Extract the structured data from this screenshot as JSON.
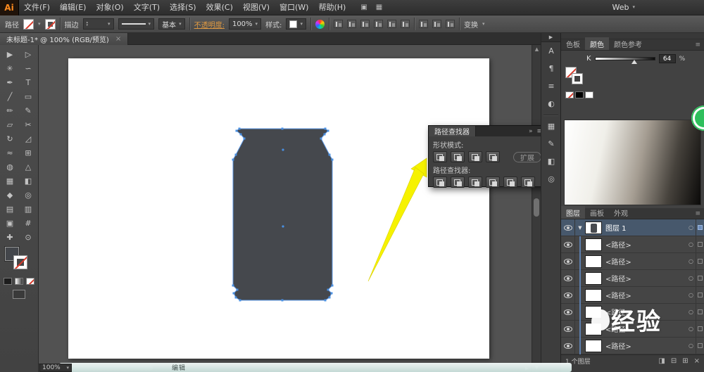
{
  "app": {
    "logo_text": "Ai",
    "workspace_label": "Web"
  },
  "menu": {
    "items": [
      "文件(F)",
      "编辑(E)",
      "对象(O)",
      "文字(T)",
      "选择(S)",
      "效果(C)",
      "视图(V)",
      "窗口(W)",
      "帮助(H)"
    ]
  },
  "control_bar": {
    "context_label": "路径",
    "stroke_label": "描边",
    "brush_value": "基本",
    "opacity_label": "不透明度:",
    "opacity_value": "100%",
    "style_label": "样式:",
    "transform_label": "变换"
  },
  "document_tab": {
    "title": "未标题-1* @ 100% (RGB/预览)"
  },
  "tools": [
    {
      "name": "selection",
      "glyph": "▶"
    },
    {
      "name": "direct-selection",
      "glyph": "▷"
    },
    {
      "name": "magic-wand",
      "glyph": "✳"
    },
    {
      "name": "lasso",
      "glyph": "∽"
    },
    {
      "name": "pen",
      "glyph": "✒"
    },
    {
      "name": "type",
      "glyph": "T"
    },
    {
      "name": "line-segment",
      "glyph": "╱"
    },
    {
      "name": "rectangle",
      "glyph": "▭"
    },
    {
      "name": "paintbrush",
      "glyph": "✏"
    },
    {
      "name": "pencil",
      "glyph": "✎"
    },
    {
      "name": "eraser",
      "glyph": "▱"
    },
    {
      "name": "scissors",
      "glyph": "✂"
    },
    {
      "name": "rotate",
      "glyph": "↻"
    },
    {
      "name": "scale",
      "glyph": "◿"
    },
    {
      "name": "width",
      "glyph": "≈"
    },
    {
      "name": "free-transform",
      "glyph": "⊞"
    },
    {
      "name": "shape-builder",
      "glyph": "◍"
    },
    {
      "name": "perspective-grid",
      "glyph": "△"
    },
    {
      "name": "mesh",
      "glyph": "▦"
    },
    {
      "name": "gradient",
      "glyph": "◧"
    },
    {
      "name": "eyedropper",
      "glyph": "◆"
    },
    {
      "name": "blend",
      "glyph": "◎"
    },
    {
      "name": "symbol-sprayer",
      "glyph": "▤"
    },
    {
      "name": "column-graph",
      "glyph": "▥"
    },
    {
      "name": "artboard",
      "glyph": "▣"
    },
    {
      "name": "slice",
      "glyph": "#"
    },
    {
      "name": "hand",
      "glyph": "✚"
    },
    {
      "name": "zoom",
      "glyph": "⊙"
    }
  ],
  "pathfinder_panel": {
    "title": "路径查找器",
    "shape_modes_label": "形状模式:",
    "pathfinder_label": "路径查找器:",
    "expand_button": "扩展"
  },
  "color_panel": {
    "tabs": [
      "色板",
      "颜色",
      "颜色参考"
    ],
    "channel": "K",
    "value": "64",
    "unit": "%"
  },
  "layers_panel": {
    "tabs": [
      "图层",
      "画板",
      "外观"
    ],
    "rows": [
      {
        "name": "图层 1"
      },
      {
        "name": "<路径>"
      },
      {
        "name": "<路径>"
      },
      {
        "name": "<路径>"
      },
      {
        "name": "<路径>"
      },
      {
        "name": "<路径>"
      },
      {
        "name": "<路径>"
      },
      {
        "name": "<路径>"
      }
    ],
    "status": "1 个图层"
  },
  "dock_strip": {
    "icons": [
      {
        "name": "type-panel",
        "glyph": "A"
      },
      {
        "name": "paragraph-panel",
        "glyph": "¶"
      },
      {
        "name": "stroke-panel",
        "glyph": "≡"
      },
      {
        "name": "transparency-panel",
        "glyph": "◐"
      },
      {
        "name": "symbols-panel",
        "glyph": "▦"
      },
      {
        "name": "brushes-panel",
        "glyph": "✎"
      },
      {
        "name": "gradient-panel",
        "glyph": "◧"
      },
      {
        "name": "appearance-panel",
        "glyph": "◎"
      }
    ]
  },
  "status_bar": {
    "zoom": "100%"
  },
  "overlay": {
    "watermark_text": "经验",
    "caption_text": "编辑"
  },
  "icons": {
    "caret_down": "▾",
    "caret_up": "▴",
    "bridge": "▣",
    "arrange_docs": "▦",
    "tab_close": "×",
    "double_arrow": "»",
    "panel_menu": "≡",
    "expand_panels": "▶",
    "expand_tri": "▼",
    "target_circle": "○",
    "scroll_up": "▲",
    "scroll_down": "▼",
    "scroll_left": "◀",
    "scroll_right": "▶",
    "make_mask": "◨",
    "new_sublayer": "⊟",
    "new_layer": "⊞",
    "delete_layer": "×"
  },
  "colors": {
    "selection_blue": "#47586c",
    "anchor_blue": "#4a90e2",
    "arrow_yellow": "#f6f200",
    "badge_green": "#2fbf5c",
    "opacity_link_orange": "#e09a42",
    "can_fill_gray": "#45484d"
  }
}
